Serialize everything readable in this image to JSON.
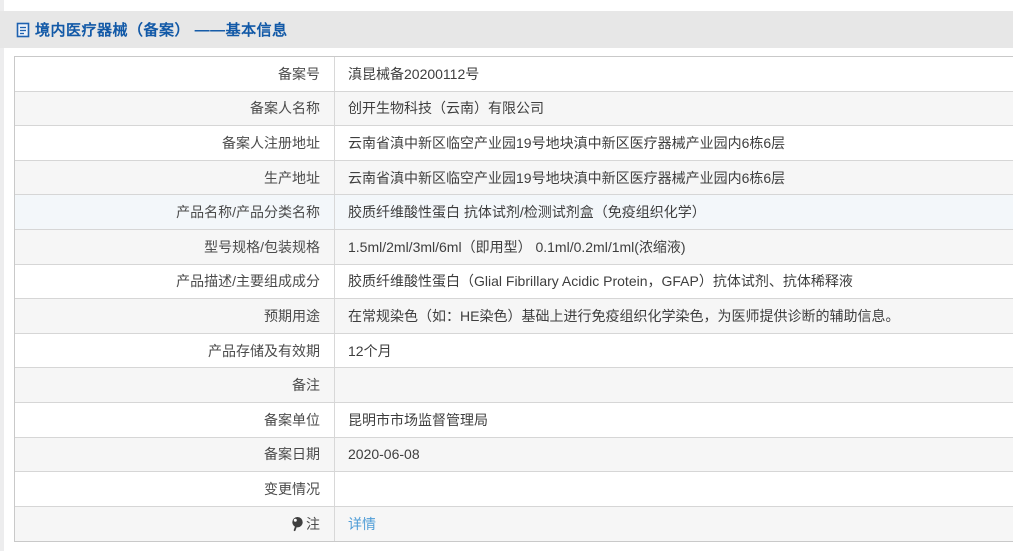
{
  "page": {
    "title": "境内医疗器械（备案） ——基本信息",
    "title_icon": "document-icon"
  },
  "colors": {
    "title_blue": "#1259a7",
    "link_blue": "#4f9dd7",
    "band_gray": "#e7e7e7",
    "alt_row_gray": "#f6f6f6",
    "border_gray": "#d6d6d6"
  },
  "icons": {
    "header": "document-icon",
    "note_row": "bulb-icon"
  },
  "table": {
    "rows": [
      {
        "label": "备案号",
        "value": "滇昆械备20200112号"
      },
      {
        "label": "备案人名称",
        "value": "创开生物科技（云南）有限公司"
      },
      {
        "label": "备案人注册地址",
        "value": "云南省滇中新区临空产业园19号地块滇中新区医疗器械产业园内6栋6层"
      },
      {
        "label": "生产地址",
        "value": "云南省滇中新区临空产业园19号地块滇中新区医疗器械产业园内6栋6层"
      },
      {
        "label": "产品名称/产品分类名称",
        "value": "胶质纤维酸性蛋白 抗体试剂/检测试剂盒（免疫组织化学）",
        "highlight": true
      },
      {
        "label": "型号规格/包装规格",
        "value": "1.5ml/2ml/3ml/6ml（即用型） 0.1ml/0.2ml/1ml(浓缩液)"
      },
      {
        "label": "产品描述/主要组成成分",
        "value": "胶质纤维酸性蛋白（Glial Fibrillary Acidic Protein，GFAP）抗体试剂、抗体稀释液"
      },
      {
        "label": "预期用途",
        "value": "在常规染色（如：HE染色）基础上进行免疫组织化学染色，为医师提供诊断的辅助信息。"
      },
      {
        "label": "产品存储及有效期",
        "value": "12个月"
      },
      {
        "label": "备注",
        "value": ""
      },
      {
        "label": "备案单位",
        "value": "昆明市市场监督管理局"
      },
      {
        "label": "备案日期",
        "value": "2020-06-08"
      },
      {
        "label": "变更情况",
        "value": ""
      },
      {
        "label": "注",
        "value": "详情",
        "link": true,
        "label_icon": "bulb-icon"
      }
    ]
  }
}
